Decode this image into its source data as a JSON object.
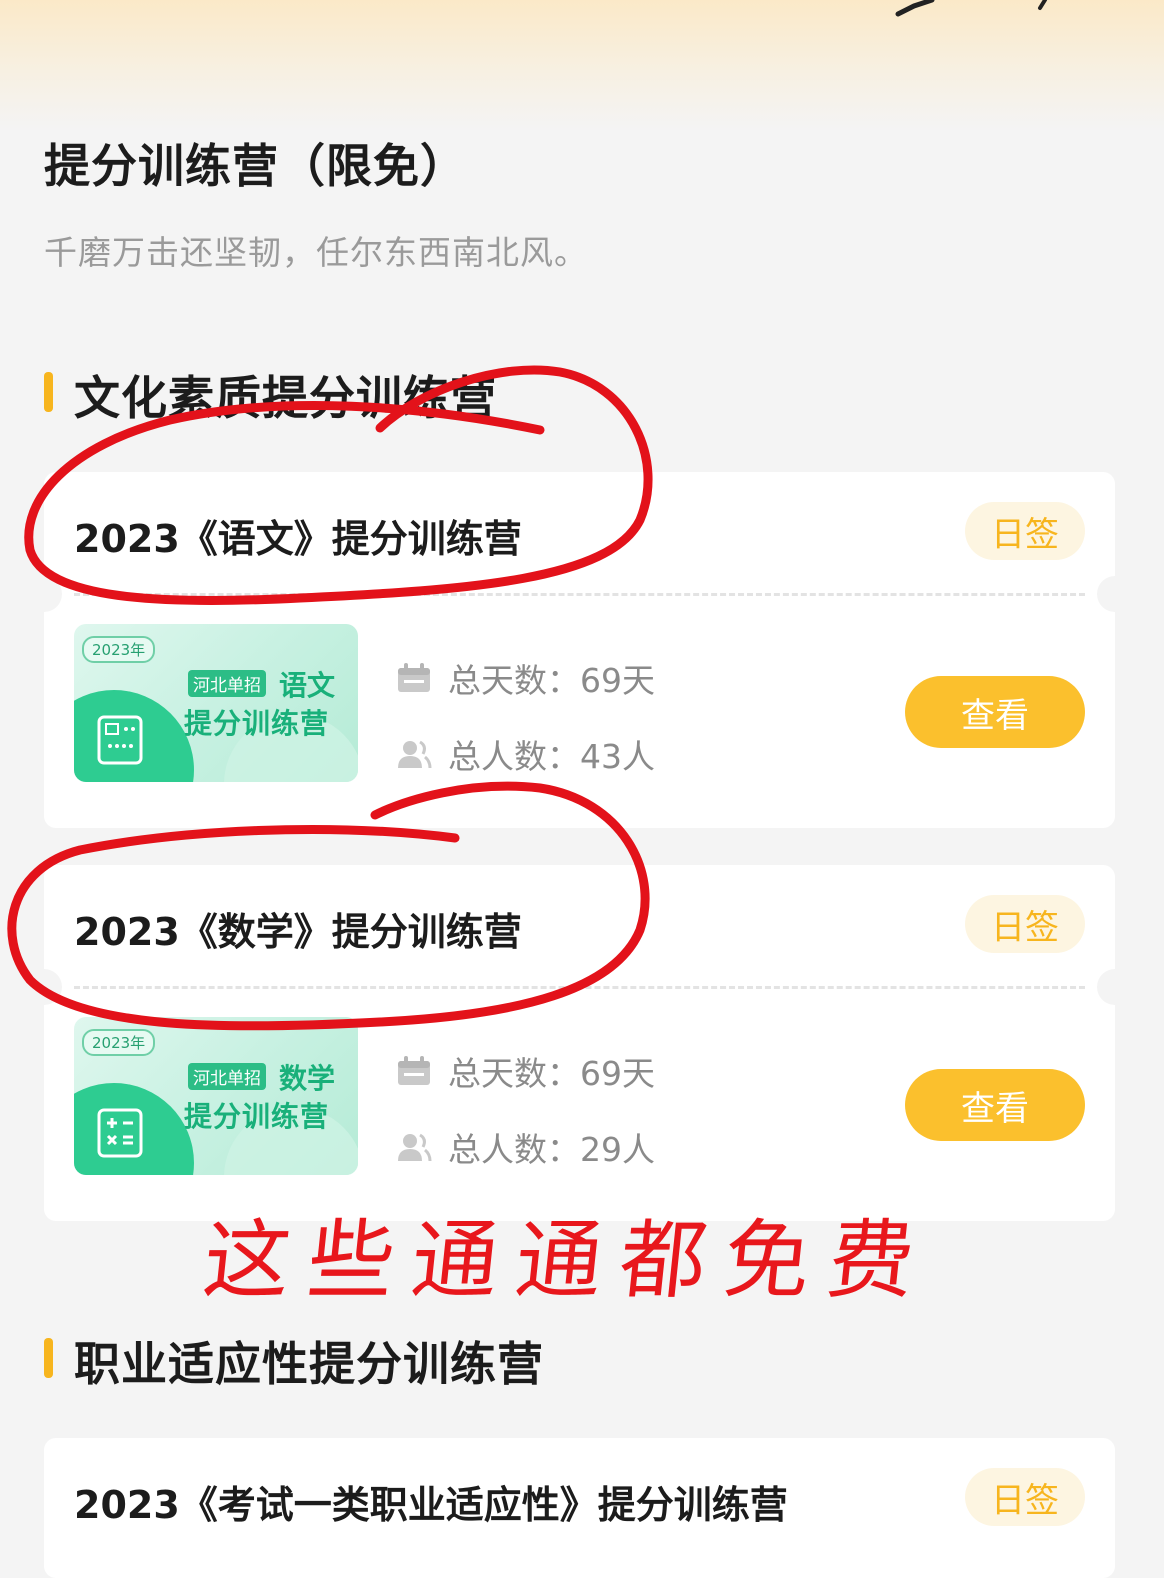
{
  "header": {
    "title": "提分训练营（限免）",
    "subtitle": "千磨万击还坚韧，任尔东西南北风。"
  },
  "sections": [
    {
      "title": "文化素质提分训练营",
      "cards": [
        {
          "title": "2023《语文》提分训练营",
          "tag": "日签",
          "thumb": {
            "year": "2023年",
            "tag": "河北单招",
            "subject": "语文",
            "line2": "提分训练营",
            "icon": "book-icon"
          },
          "days_label": "总天数：69天",
          "people_label": "总人数：43人",
          "button": "查看"
        },
        {
          "title": "2023《数学》提分训练营",
          "tag": "日签",
          "thumb": {
            "year": "2023年",
            "tag": "河北单招",
            "subject": "数学",
            "line2": "提分训练营",
            "icon": "calculator-icon"
          },
          "days_label": "总天数：69天",
          "people_label": "总人数：29人",
          "button": "查看"
        }
      ]
    },
    {
      "title": "职业适应性提分训练营",
      "cards": [
        {
          "title": "2023《考试一类职业适应性》提分训练营",
          "tag": "日签"
        }
      ]
    }
  ],
  "annotation": {
    "text": "这些通通都免费",
    "color": "#e8171c"
  },
  "colors": {
    "accent": "#fbc02d",
    "tag_text": "#f7b51e",
    "thumb_green": "#2ecc91"
  }
}
